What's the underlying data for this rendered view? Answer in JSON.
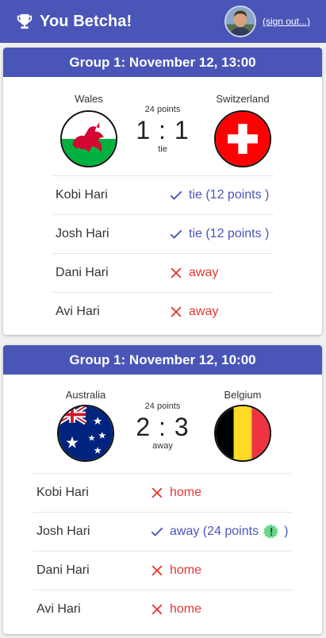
{
  "app": {
    "title": "You Betcha!",
    "sign_out": "(sign out...)"
  },
  "matches": [
    {
      "header": "Group 1: November 12, 13:00",
      "home": {
        "name": "Wales",
        "flag": "wales-flag"
      },
      "away": {
        "name": "Switzerland",
        "flag": "switzerland-flag"
      },
      "points": "24 points",
      "score": "1 : 1",
      "result": "tie",
      "bets": [
        {
          "player": "Kobi Hari",
          "pick": "tie (12 points )",
          "correct": true
        },
        {
          "player": "Josh Hari",
          "pick": "tie (12 points )",
          "correct": true
        },
        {
          "player": "Dani Hari",
          "pick": "away",
          "correct": false
        },
        {
          "player": "Avi Hari",
          "pick": "away",
          "correct": false
        }
      ]
    },
    {
      "header": "Group 1: November 12, 10:00",
      "home": {
        "name": "Australia",
        "flag": "australia-flag"
      },
      "away": {
        "name": "Belgium",
        "flag": "belgium-flag"
      },
      "points": "24 points",
      "score": "2 : 3",
      "result": "away",
      "bets": [
        {
          "player": "Kobi Hari",
          "pick": "home",
          "correct": false
        },
        {
          "player": "Josh Hari",
          "pick_prefix": "away (24 points",
          "pick_suffix": ")",
          "correct": true,
          "badge": "exclamation-badge-icon"
        },
        {
          "player": "Dani Hari",
          "pick": "home",
          "correct": false
        },
        {
          "player": "Avi Hari",
          "pick": "home",
          "correct": false
        }
      ]
    }
  ],
  "colors": {
    "primary": "#4a55b8",
    "correct": "#4a55b8",
    "wrong": "#e53935",
    "badge": "#66d98a"
  }
}
